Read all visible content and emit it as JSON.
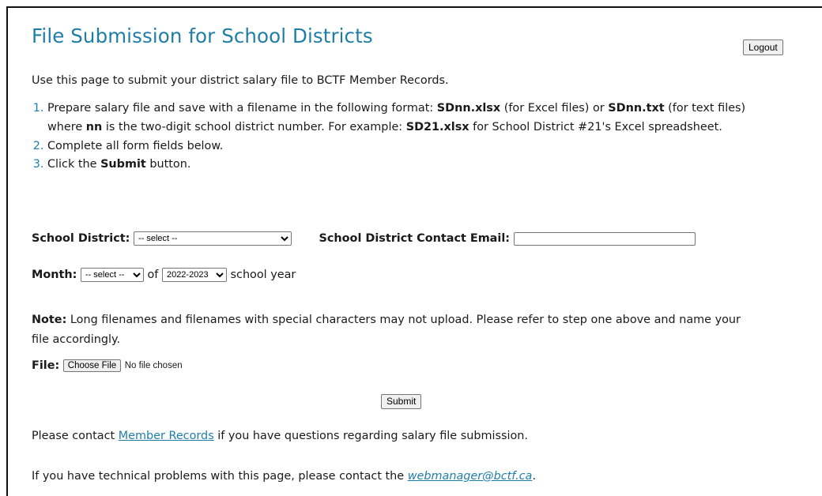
{
  "page": {
    "title": "File Submission for School Districts",
    "logout_label": "Logout",
    "intro": "Use this page to submit your district salary file to BCTF Member Records."
  },
  "steps": {
    "step1": {
      "t1": "Prepare salary file and save with a filename in the following format: ",
      "b1": "SDnn.xlsx",
      "t2": " (for Excel files) or ",
      "b2": "SDnn.txt",
      "t3": " (for text files) where ",
      "b3": "nn",
      "t4": " is the two-digit school district number. For example: ",
      "b4": "SD21.xlsx",
      "t5": " for School District #21's Excel spreadsheet."
    },
    "step2": "Complete all form fields below.",
    "step3": {
      "t1": "Click the ",
      "b1": "Submit",
      "t2": " button."
    }
  },
  "form": {
    "district_label": "School District:",
    "district_selected": "-- select --",
    "email_label": "School District Contact Email:",
    "email_value": "",
    "month_label": "Month:",
    "month_selected": "-- select --",
    "of_text": "of",
    "year_selected": "2022-2023",
    "school_year_text": "school year",
    "note_label": "Note:",
    "note_text": " Long filenames and filenames with special characters may not upload. Please refer to step one above and name your file accordingly.",
    "file_label": "File:",
    "choose_file_label": "Choose File",
    "file_status": "No file chosen",
    "submit_label": "Submit"
  },
  "footer": {
    "contact_pre": "Please contact ",
    "contact_link": "Member Records",
    "contact_post": " if you have questions regarding salary file submission.",
    "tech_pre": "If you have technical problems with this page, please contact the ",
    "tech_link": "webmanager@bctf.ca",
    "tech_post": "."
  },
  "colors": {
    "accent": "#1f7ea8",
    "text": "#1a1a1a",
    "border": "#111111"
  }
}
